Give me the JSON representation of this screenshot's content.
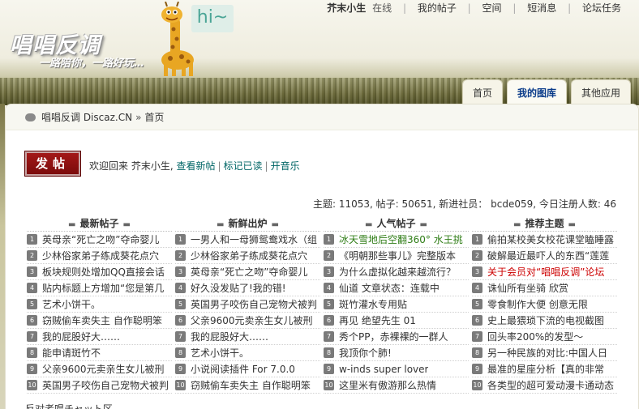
{
  "logo": {
    "title": "唱唱反调",
    "slogan": "一路陪你，一路好玩…",
    "bubble": "hi~"
  },
  "top_links": {
    "user": "芥末小生",
    "status": "在线",
    "items": [
      "我的帖子",
      "空间",
      "短消息",
      "论坛任务"
    ]
  },
  "main_nav": {
    "tabs": [
      {
        "label": "首页",
        "active": false
      },
      {
        "label": "我的图库",
        "active": true
      },
      {
        "label": "其他应用",
        "active": false
      }
    ]
  },
  "breadcrumb": {
    "site": "唱唱反调 Discaz.CN",
    "separator": "»",
    "current": "首页"
  },
  "post_button": {
    "label": "发帖"
  },
  "welcome": {
    "text": "欢迎回来  芥末小生,",
    "links": [
      "查看新帖",
      "标记已读",
      "开音乐"
    ],
    "sep": "|"
  },
  "stats": {
    "text": "主题: 11053, 帖子: 50651, 新进社员： bcde059, 今日注册人数: 46"
  },
  "columns": [
    {
      "heading": "最新帖子",
      "rows": [
        {
          "num": "1",
          "text": "英母亲“死亡之吻”夺命婴儿"
        },
        {
          "num": "2",
          "text": "少林俗家弟子练成葵花点穴"
        },
        {
          "num": "3",
          "text": "板块规则处增加QQ直接会话"
        },
        {
          "num": "4",
          "text": "贴内标题上方增加“您是第几"
        },
        {
          "num": "5",
          "text": "艺术小饼干。"
        },
        {
          "num": "6",
          "text": "窃贼偷车卖失主  自作聪明笨"
        },
        {
          "num": "7",
          "text": "我的屁股好大……"
        },
        {
          "num": "8",
          "text": "能申请斑竹不"
        },
        {
          "num": "9",
          "text": "父亲9600元卖亲生女儿被刑"
        },
        {
          "num": "10",
          "text": "英国男子咬伤自己宠物犬被判"
        }
      ]
    },
    {
      "heading": "新鲜出炉",
      "rows": [
        {
          "num": "1",
          "text": "一男人和一母狮鸳鸯戏水（组"
        },
        {
          "num": "2",
          "text": "少林俗家弟子练成葵花点穴"
        },
        {
          "num": "3",
          "text": "英母亲“死亡之吻”夺命婴儿"
        },
        {
          "num": "4",
          "text": "好久没发贴了!我的错!"
        },
        {
          "num": "5",
          "text": "英国男子咬伤自己宠物犬被判"
        },
        {
          "num": "6",
          "text": "父亲9600元卖亲生女儿被刑"
        },
        {
          "num": "7",
          "text": "我的屁股好大……"
        },
        {
          "num": "8",
          "text": "艺术小饼干。"
        },
        {
          "num": "9",
          "text": "小说阅读插件 For 7.0.0"
        },
        {
          "num": "10",
          "text": "窃贼偷车卖失主  自作聪明笨"
        }
      ]
    },
    {
      "heading": "人气帖子",
      "rows": [
        {
          "num": "1",
          "text": "冰天雪地后空翻360° 水王挑",
          "style": "green"
        },
        {
          "num": "2",
          "text": "《明朝那些事儿》完整版本"
        },
        {
          "num": "3",
          "text": "为什么虚拟化越来越流行？"
        },
        {
          "num": "4",
          "text": "仙道  文章状态：连载中"
        },
        {
          "num": "5",
          "text": "斑竹灌水专用贴"
        },
        {
          "num": "6",
          "text": "再见  绝望先生  01"
        },
        {
          "num": "7",
          "text": "秀个PP，赤裸裸的一群人"
        },
        {
          "num": "8",
          "text": "我顶你个肺!"
        },
        {
          "num": "9",
          "text": "w-inds super lover"
        },
        {
          "num": "10",
          "text": "这里米有傲游那么热情"
        }
      ]
    },
    {
      "heading": "推荐主题",
      "rows": [
        {
          "num": "1",
          "text": "偷拍某校美女校花课堂瞌睡露"
        },
        {
          "num": "2",
          "text": "破解最近最吓人的东西“莲莲"
        },
        {
          "num": "3",
          "text": "关于会员对“唱唱反调”论坛",
          "style": "red"
        },
        {
          "num": "4",
          "text": "诛仙所有坐骑  欣赏"
        },
        {
          "num": "5",
          "text": "零食制作大便  创意无限"
        },
        {
          "num": "6",
          "text": "史上最猥琐下流的电视截图"
        },
        {
          "num": "7",
          "text": "回头率200%的发型～"
        },
        {
          "num": "8",
          "text": "另一种民族的对比:中国人日"
        },
        {
          "num": "9",
          "text": "最准的星座分析【真的非常"
        },
        {
          "num": "10",
          "text": "各类型的超可爱动漫卡通动态"
        }
      ]
    }
  ],
  "bottom_strip": {
    "text": "反对者唱チャット区"
  }
}
